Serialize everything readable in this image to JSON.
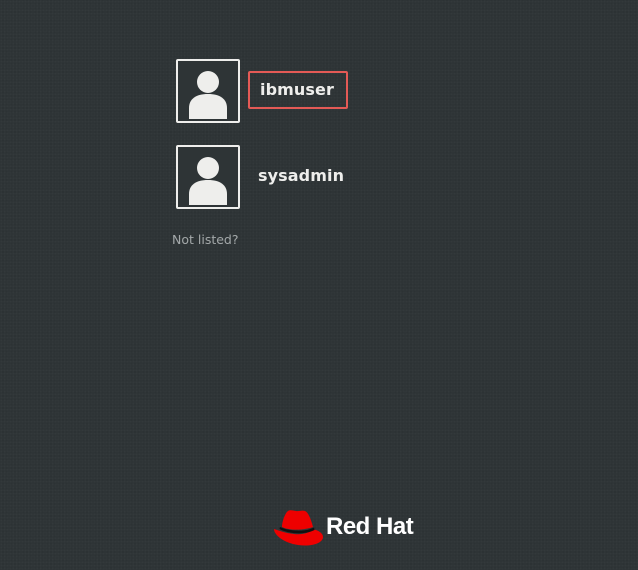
{
  "user_list": {
    "users": [
      {
        "name": "ibmuser",
        "avatar_icon": "user-silhouette-icon",
        "selected": true
      },
      {
        "name": "sysadmin",
        "avatar_icon": "user-silhouette-icon",
        "selected": false
      }
    ],
    "not_listed_label": "Not listed?"
  },
  "branding": {
    "logo_icon": "red-hat-fedora-icon",
    "logo_text": "Red Hat"
  },
  "colors": {
    "background": "#2e3436",
    "text": "#eeeeec",
    "muted_text": "#a3a8a9",
    "selection_border": "#e45a56",
    "brand_red": "#ee0000"
  }
}
